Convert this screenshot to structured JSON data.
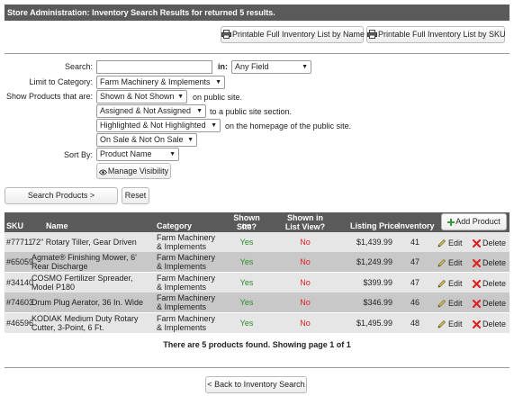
{
  "header": {
    "title": "Store Administration: Inventory Search Results for returned 5 results."
  },
  "toolbar": {
    "print_by_name": "Printable Full Inventory List by Name",
    "print_by_sku": "Printable Full Inventory List by SKU"
  },
  "search_form": {
    "search_label": "Search:",
    "search_value": "",
    "in_label": "in:",
    "in_value": "Any Field",
    "category_label": "Limit to Category:",
    "category_value": "Farm Machinery & Implements",
    "show_label": "Show Products that are:",
    "filters": [
      {
        "value": "Shown & Not Shown",
        "suffix": "on public site."
      },
      {
        "value": "Assigned & Not Assigned",
        "suffix": "to a public site section."
      },
      {
        "value": "Highlighted & Not Highlighted",
        "suffix": "on the homepage of the public site."
      },
      {
        "value": "On Sale & Not On Sale",
        "suffix": ""
      }
    ],
    "sort_label": "Sort By:",
    "sort_value": "Product Name",
    "manage_visibility": "Manage Visibility",
    "search_button": "Search Products >",
    "reset_button": "Reset"
  },
  "table": {
    "headers": {
      "sku": "SKU",
      "name": "Name",
      "category": "Category",
      "shown_line1": "Shown on",
      "shown_line2": "Site?",
      "inlist_line1": "Shown in",
      "inlist_line2": "List View?",
      "price": "Listing Price",
      "inventory": "Inventory",
      "add_product": "Add Product"
    },
    "rows": [
      {
        "sku": "#77711",
        "name1": "72\" Rotary Tiller, Gear Driven",
        "name2": "",
        "cat1": "Farm Machinery",
        "cat2": "& Implements",
        "shown": "Yes",
        "inlist": "No",
        "price": "$1,439.99",
        "inventory": "41"
      },
      {
        "sku": "#65059",
        "name1": "Agmate® Finishing Mower, 6'",
        "name2": "Rear Discharge",
        "cat1": "Farm Machinery",
        "cat2": "& Implements",
        "shown": "Yes",
        "inlist": "No",
        "price": "$1,249.99",
        "inventory": "47"
      },
      {
        "sku": "#34140",
        "name1": "COSMO Fertilizer Spreader,",
        "name2": "Model P180",
        "cat1": "Farm Machinery",
        "cat2": "& Implements",
        "shown": "Yes",
        "inlist": "No",
        "price": "$399.99",
        "inventory": "47"
      },
      {
        "sku": "#74603",
        "name1": "Drum Plug Aerator, 36 In. Wide",
        "name2": "",
        "cat1": "Farm Machinery",
        "cat2": "& Implements",
        "shown": "Yes",
        "inlist": "No",
        "price": "$346.99",
        "inventory": "46"
      },
      {
        "sku": "#46596",
        "name1": "KODIAK Medium Duty Rotary",
        "name2": "Cutter, 3-Point, 6 Ft.",
        "cat1": "Farm Machinery",
        "cat2": "& Implements",
        "shown": "Yes",
        "inlist": "No",
        "price": "$1,495.99",
        "inventory": "48"
      }
    ],
    "edit_label": "Edit",
    "delete_label": "Delete"
  },
  "pagination": {
    "summary": "There are 5 products found.   Showing page 1 of 1"
  },
  "back_button": "< Back to Inventory Search",
  "colors": {
    "header_bg": "#5a5a5a",
    "yes": "#2e8b2e",
    "no": "#dd2222",
    "row_odd": "#e6e6e6",
    "row_even": "#c8c8c8"
  }
}
